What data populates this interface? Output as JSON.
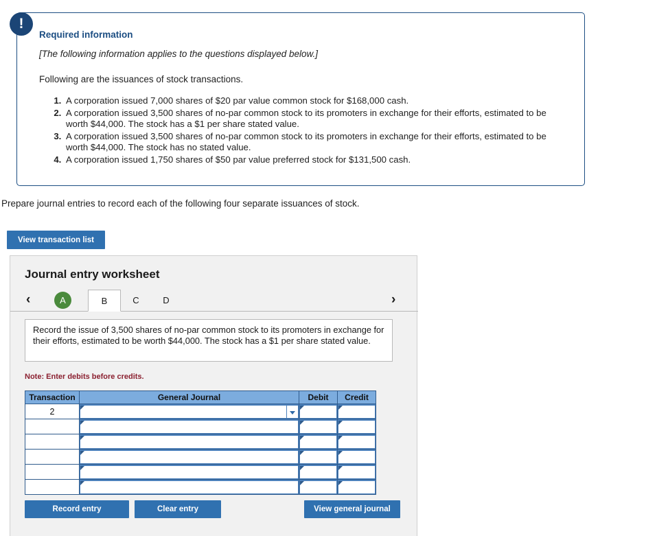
{
  "required_info": {
    "icon": "exclamation-icon",
    "title": "Required information",
    "applies_note": "[The following information applies to the questions displayed below.]",
    "lead": "Following are the issuances of stock transactions.",
    "items": [
      "A corporation issued 7,000 shares of $20 par value common stock for $168,000 cash.",
      "A corporation issued 3,500 shares of no-par common stock to its promoters in exchange for their efforts, estimated to be worth $44,000. The stock has a $1 per share stated value.",
      "A corporation issued 3,500 shares of no-par common stock to its promoters in exchange for their efforts, estimated to be worth $44,000. The stock has no stated value.",
      "A corporation issued 1,750 shares of $50 par value preferred stock for $131,500 cash."
    ],
    "border_color": "#1b4d82",
    "icon_color": "#1b4576"
  },
  "prepare_instruction": "Prepare journal entries to record each of the following four separate issuances of stock.",
  "toolbar": {
    "view_transaction_list_label": "View transaction list"
  },
  "worksheet": {
    "title": "Journal entry worksheet",
    "nav": {
      "prev_icon": "chevron-left-icon",
      "prev_glyph": "‹",
      "next_icon": "chevron-right-icon",
      "next_glyph": "›"
    },
    "tabs": [
      {
        "label": "A",
        "state": "completed"
      },
      {
        "label": "B",
        "state": "active"
      },
      {
        "label": "C",
        "state": "inactive"
      },
      {
        "label": "D",
        "state": "inactive"
      }
    ],
    "completed_color": "#4a8a3c",
    "prompt": "Record the issue of 3,500 shares of no-par common stock to its promoters in exchange for their efforts, estimated to be worth $44,000. The stock has a $1 per share stated value.",
    "note": "Note: Enter debits before credits.",
    "note_color": "#8b2030",
    "table": {
      "headers": [
        "Transaction",
        "General Journal",
        "Debit",
        "Credit"
      ],
      "header_bg": "#7cacde",
      "rows": [
        {
          "transaction": "2",
          "general_journal": "",
          "debit": "",
          "credit": "",
          "has_dropdown": true
        },
        {
          "transaction": "",
          "general_journal": "",
          "debit": "",
          "credit": "",
          "has_dropdown": false
        },
        {
          "transaction": "",
          "general_journal": "",
          "debit": "",
          "credit": "",
          "has_dropdown": false
        },
        {
          "transaction": "",
          "general_journal": "",
          "debit": "",
          "credit": "",
          "has_dropdown": false
        },
        {
          "transaction": "",
          "general_journal": "",
          "debit": "",
          "credit": "",
          "has_dropdown": false
        },
        {
          "transaction": "",
          "general_journal": "",
          "debit": "",
          "credit": "",
          "has_dropdown": false
        }
      ]
    },
    "footer": {
      "record_entry_label": "Record entry",
      "clear_entry_label": "Clear entry",
      "view_general_journal_label": "View general journal",
      "button_color": "#3071b0"
    }
  }
}
